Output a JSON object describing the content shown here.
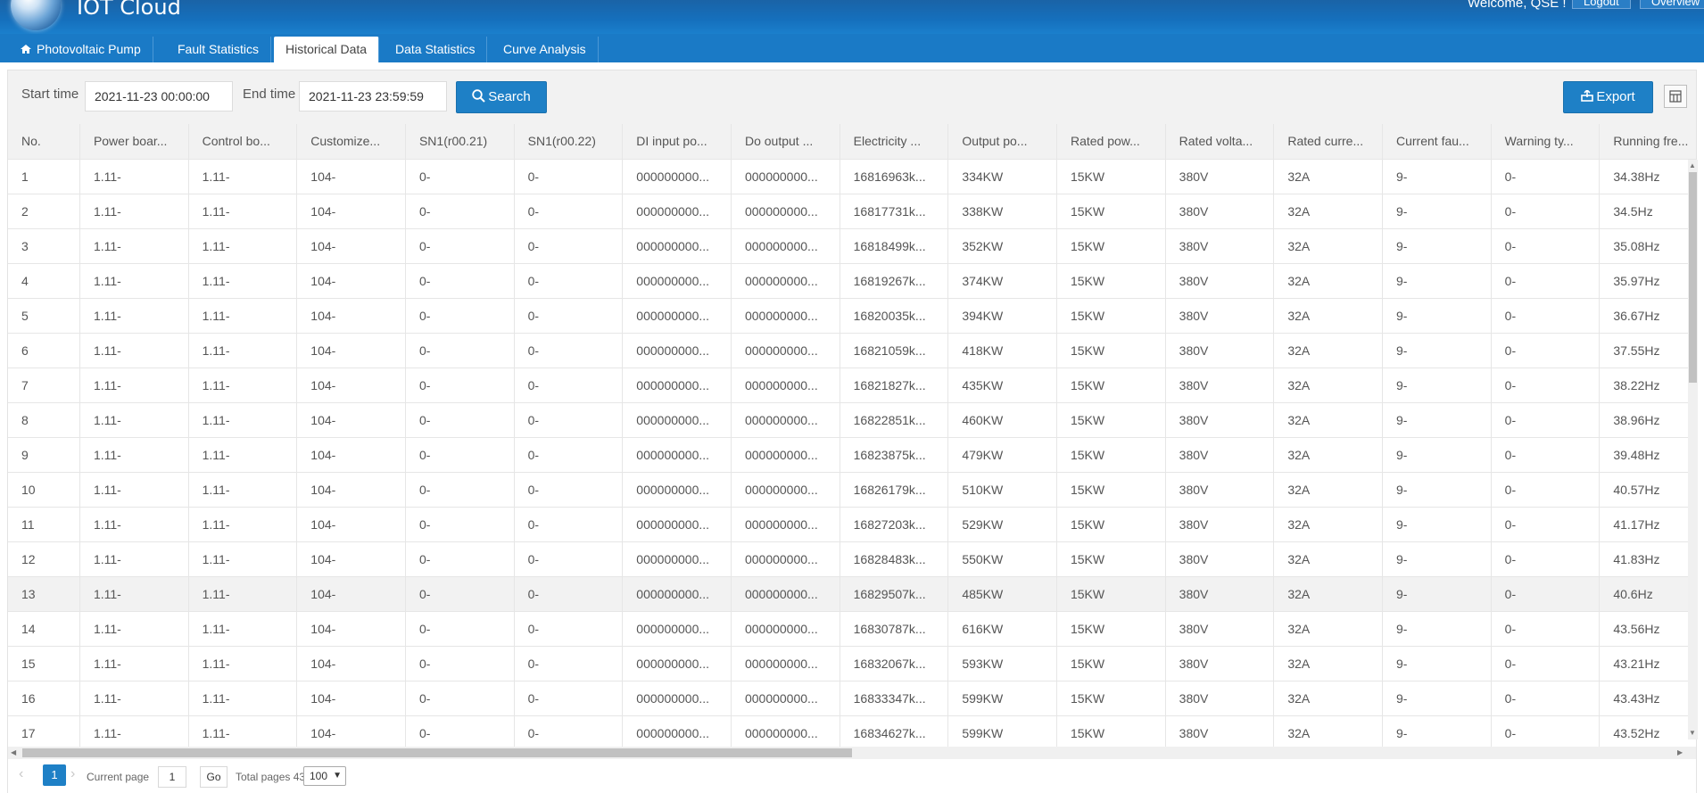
{
  "header": {
    "app_title": "IOT Cloud",
    "welcome": "Welcome, QSE !",
    "logout_label": "Logout",
    "overview_label": "Overview"
  },
  "nav": {
    "tabs": [
      {
        "label": "Photovoltaic Pump",
        "icon": "home-icon"
      },
      {
        "label": "Fault Statistics"
      },
      {
        "label": "Historical Data",
        "active": true
      },
      {
        "label": "Data Statistics"
      },
      {
        "label": "Curve Analysis"
      }
    ]
  },
  "toolbar": {
    "start_label": "Start time",
    "start_value": "2021-11-23 00:00:00",
    "end_label": "End time",
    "end_value": "2021-11-23 23:59:59",
    "search_label": "Search",
    "export_label": "Export"
  },
  "table": {
    "columns": [
      "No.",
      "Power boar...",
      "Control bo...",
      "Customize...",
      "SN1(r00.21)",
      "SN1(r00.22)",
      "DI input po...",
      "Do output ...",
      "Electricity ...",
      "Output po...",
      "Rated pow...",
      "Rated volta...",
      "Rated curre...",
      "Current fau...",
      "Warning ty...",
      "Running fre..."
    ],
    "rows": [
      [
        "1",
        "1.11-",
        "1.11-",
        "104-",
        "0-",
        "0-",
        "000000000...",
        "000000000...",
        "16816963k...",
        "334KW",
        "15KW",
        "380V",
        "32A",
        "9-",
        "0-",
        "34.38Hz"
      ],
      [
        "2",
        "1.11-",
        "1.11-",
        "104-",
        "0-",
        "0-",
        "000000000...",
        "000000000...",
        "16817731k...",
        "338KW",
        "15KW",
        "380V",
        "32A",
        "9-",
        "0-",
        "34.5Hz"
      ],
      [
        "3",
        "1.11-",
        "1.11-",
        "104-",
        "0-",
        "0-",
        "000000000...",
        "000000000...",
        "16818499k...",
        "352KW",
        "15KW",
        "380V",
        "32A",
        "9-",
        "0-",
        "35.08Hz"
      ],
      [
        "4",
        "1.11-",
        "1.11-",
        "104-",
        "0-",
        "0-",
        "000000000...",
        "000000000...",
        "16819267k...",
        "374KW",
        "15KW",
        "380V",
        "32A",
        "9-",
        "0-",
        "35.97Hz"
      ],
      [
        "5",
        "1.11-",
        "1.11-",
        "104-",
        "0-",
        "0-",
        "000000000...",
        "000000000...",
        "16820035k...",
        "394KW",
        "15KW",
        "380V",
        "32A",
        "9-",
        "0-",
        "36.67Hz"
      ],
      [
        "6",
        "1.11-",
        "1.11-",
        "104-",
        "0-",
        "0-",
        "000000000...",
        "000000000...",
        "16821059k...",
        "418KW",
        "15KW",
        "380V",
        "32A",
        "9-",
        "0-",
        "37.55Hz"
      ],
      [
        "7",
        "1.11-",
        "1.11-",
        "104-",
        "0-",
        "0-",
        "000000000...",
        "000000000...",
        "16821827k...",
        "435KW",
        "15KW",
        "380V",
        "32A",
        "9-",
        "0-",
        "38.22Hz"
      ],
      [
        "8",
        "1.11-",
        "1.11-",
        "104-",
        "0-",
        "0-",
        "000000000...",
        "000000000...",
        "16822851k...",
        "460KW",
        "15KW",
        "380V",
        "32A",
        "9-",
        "0-",
        "38.96Hz"
      ],
      [
        "9",
        "1.11-",
        "1.11-",
        "104-",
        "0-",
        "0-",
        "000000000...",
        "000000000...",
        "16823875k...",
        "479KW",
        "15KW",
        "380V",
        "32A",
        "9-",
        "0-",
        "39.48Hz"
      ],
      [
        "10",
        "1.11-",
        "1.11-",
        "104-",
        "0-",
        "0-",
        "000000000...",
        "000000000...",
        "16826179k...",
        "510KW",
        "15KW",
        "380V",
        "32A",
        "9-",
        "0-",
        "40.57Hz"
      ],
      [
        "11",
        "1.11-",
        "1.11-",
        "104-",
        "0-",
        "0-",
        "000000000...",
        "000000000...",
        "16827203k...",
        "529KW",
        "15KW",
        "380V",
        "32A",
        "9-",
        "0-",
        "41.17Hz"
      ],
      [
        "12",
        "1.11-",
        "1.11-",
        "104-",
        "0-",
        "0-",
        "000000000...",
        "000000000...",
        "16828483k...",
        "550KW",
        "15KW",
        "380V",
        "32A",
        "9-",
        "0-",
        "41.83Hz"
      ],
      [
        "13",
        "1.11-",
        "1.11-",
        "104-",
        "0-",
        "0-",
        "000000000...",
        "000000000...",
        "16829507k...",
        "485KW",
        "15KW",
        "380V",
        "32A",
        "9-",
        "0-",
        "40.6Hz"
      ],
      [
        "14",
        "1.11-",
        "1.11-",
        "104-",
        "0-",
        "0-",
        "000000000...",
        "000000000...",
        "16830787k...",
        "616KW",
        "15KW",
        "380V",
        "32A",
        "9-",
        "0-",
        "43.56Hz"
      ],
      [
        "15",
        "1.11-",
        "1.11-",
        "104-",
        "0-",
        "0-",
        "000000000...",
        "000000000...",
        "16832067k...",
        "593KW",
        "15KW",
        "380V",
        "32A",
        "9-",
        "0-",
        "43.21Hz"
      ],
      [
        "16",
        "1.11-",
        "1.11-",
        "104-",
        "0-",
        "0-",
        "000000000...",
        "000000000...",
        "16833347k...",
        "599KW",
        "15KW",
        "380V",
        "32A",
        "9-",
        "0-",
        "43.43Hz"
      ],
      [
        "17",
        "1.11-",
        "1.11-",
        "104-",
        "0-",
        "0-",
        "000000000...",
        "000000000...",
        "16834627k...",
        "599KW",
        "15KW",
        "380V",
        "32A",
        "9-",
        "0-",
        "43.52Hz"
      ]
    ],
    "highlighted_row": "13"
  },
  "pager": {
    "current": "1",
    "current_page_label": "Current page",
    "page_input_value": "1",
    "go_label": "Go",
    "total_label": "Total pages 43",
    "page_size": "100"
  },
  "colors": {
    "accent": "#1e80c6",
    "header": "#1570bd",
    "nav": "#1a7ac6"
  }
}
